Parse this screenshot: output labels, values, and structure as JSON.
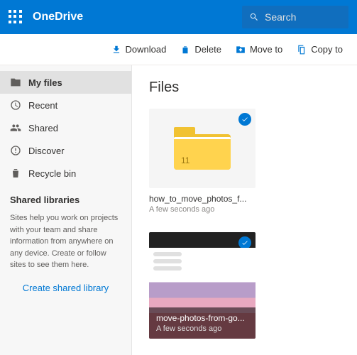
{
  "header": {
    "brand": "OneDrive",
    "search_placeholder": "Search"
  },
  "toolbar": {
    "download": "Download",
    "delete": "Delete",
    "move_to": "Move to",
    "copy_to": "Copy to"
  },
  "sidebar": {
    "items": [
      {
        "label": "My files"
      },
      {
        "label": "Recent"
      },
      {
        "label": "Shared"
      },
      {
        "label": "Discover"
      },
      {
        "label": "Recycle bin"
      }
    ],
    "libraries_title": "Shared libraries",
    "libraries_desc": "Sites help you work on projects with your team and share information from anywhere on any device. Create or follow sites to see them here.",
    "create_link": "Create shared library"
  },
  "main": {
    "title": "Files",
    "items": [
      {
        "name": "how_to_move_photos_f...",
        "meta": "A few seconds ago",
        "count": "11"
      },
      {
        "name": "move-photos-from-go...",
        "meta": "A few seconds ago"
      }
    ]
  }
}
